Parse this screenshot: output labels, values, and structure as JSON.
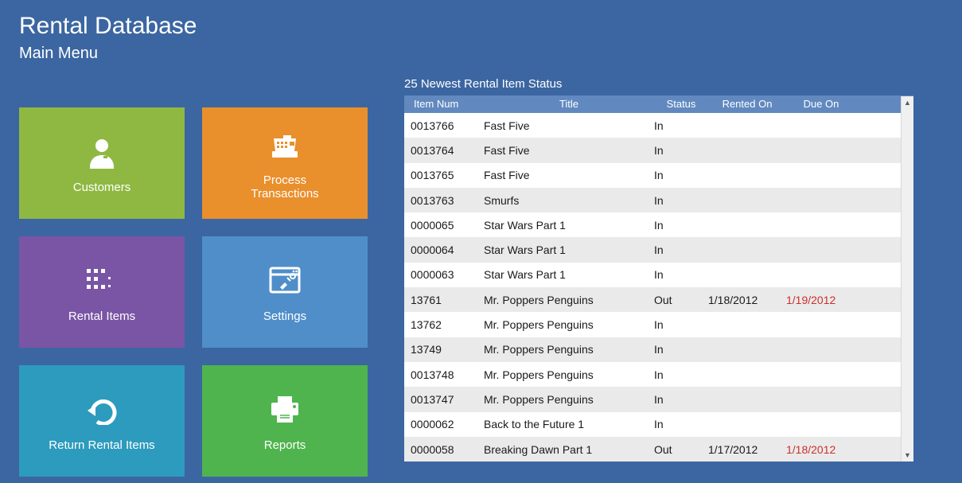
{
  "header": {
    "app_title": "Rental Database",
    "page_title": "Main Menu"
  },
  "tiles": {
    "customers": "Customers",
    "process_transactions": "Process\nTransactions",
    "rental_items": "Rental Items",
    "settings": "Settings",
    "return_rental_items": "Return Rental Items",
    "reports": "Reports"
  },
  "grid": {
    "title": "25 Newest Rental Item Status",
    "columns": {
      "item_num": "Item Num",
      "title": "Title",
      "status": "Status",
      "rented_on": "Rented On",
      "due_on": "Due On"
    },
    "rows": [
      {
        "item_num": "0013766",
        "title": "Fast Five",
        "status": "In",
        "rented_on": "",
        "due_on": "",
        "overdue": false
      },
      {
        "item_num": "0013764",
        "title": "Fast Five",
        "status": "In",
        "rented_on": "",
        "due_on": "",
        "overdue": false
      },
      {
        "item_num": "0013765",
        "title": "Fast Five",
        "status": "In",
        "rented_on": "",
        "due_on": "",
        "overdue": false
      },
      {
        "item_num": "0013763",
        "title": "Smurfs",
        "status": "In",
        "rented_on": "",
        "due_on": "",
        "overdue": false
      },
      {
        "item_num": "0000065",
        "title": "Star Wars Part 1",
        "status": "In",
        "rented_on": "",
        "due_on": "",
        "overdue": false
      },
      {
        "item_num": "0000064",
        "title": "Star Wars Part 1",
        "status": "In",
        "rented_on": "",
        "due_on": "",
        "overdue": false
      },
      {
        "item_num": "0000063",
        "title": "Star Wars Part 1",
        "status": "In",
        "rented_on": "",
        "due_on": "",
        "overdue": false
      },
      {
        "item_num": "13761",
        "title": "Mr. Poppers Penguins",
        "status": "Out",
        "rented_on": "1/18/2012",
        "due_on": "1/19/2012",
        "overdue": true
      },
      {
        "item_num": "13762",
        "title": "Mr. Poppers Penguins",
        "status": "In",
        "rented_on": "",
        "due_on": "",
        "overdue": false
      },
      {
        "item_num": "13749",
        "title": "Mr. Poppers Penguins",
        "status": "In",
        "rented_on": "",
        "due_on": "",
        "overdue": false
      },
      {
        "item_num": "0013748",
        "title": "Mr. Poppers Penguins",
        "status": "In",
        "rented_on": "",
        "due_on": "",
        "overdue": false
      },
      {
        "item_num": "0013747",
        "title": "Mr. Poppers Penguins",
        "status": "In",
        "rented_on": "",
        "due_on": "",
        "overdue": false
      },
      {
        "item_num": "0000062",
        "title": "Back to the Future 1",
        "status": "In",
        "rented_on": "",
        "due_on": "",
        "overdue": false
      },
      {
        "item_num": "0000058",
        "title": "Breaking Dawn Part 1",
        "status": "Out",
        "rented_on": "1/17/2012",
        "due_on": "1/18/2012",
        "overdue": true
      }
    ]
  }
}
